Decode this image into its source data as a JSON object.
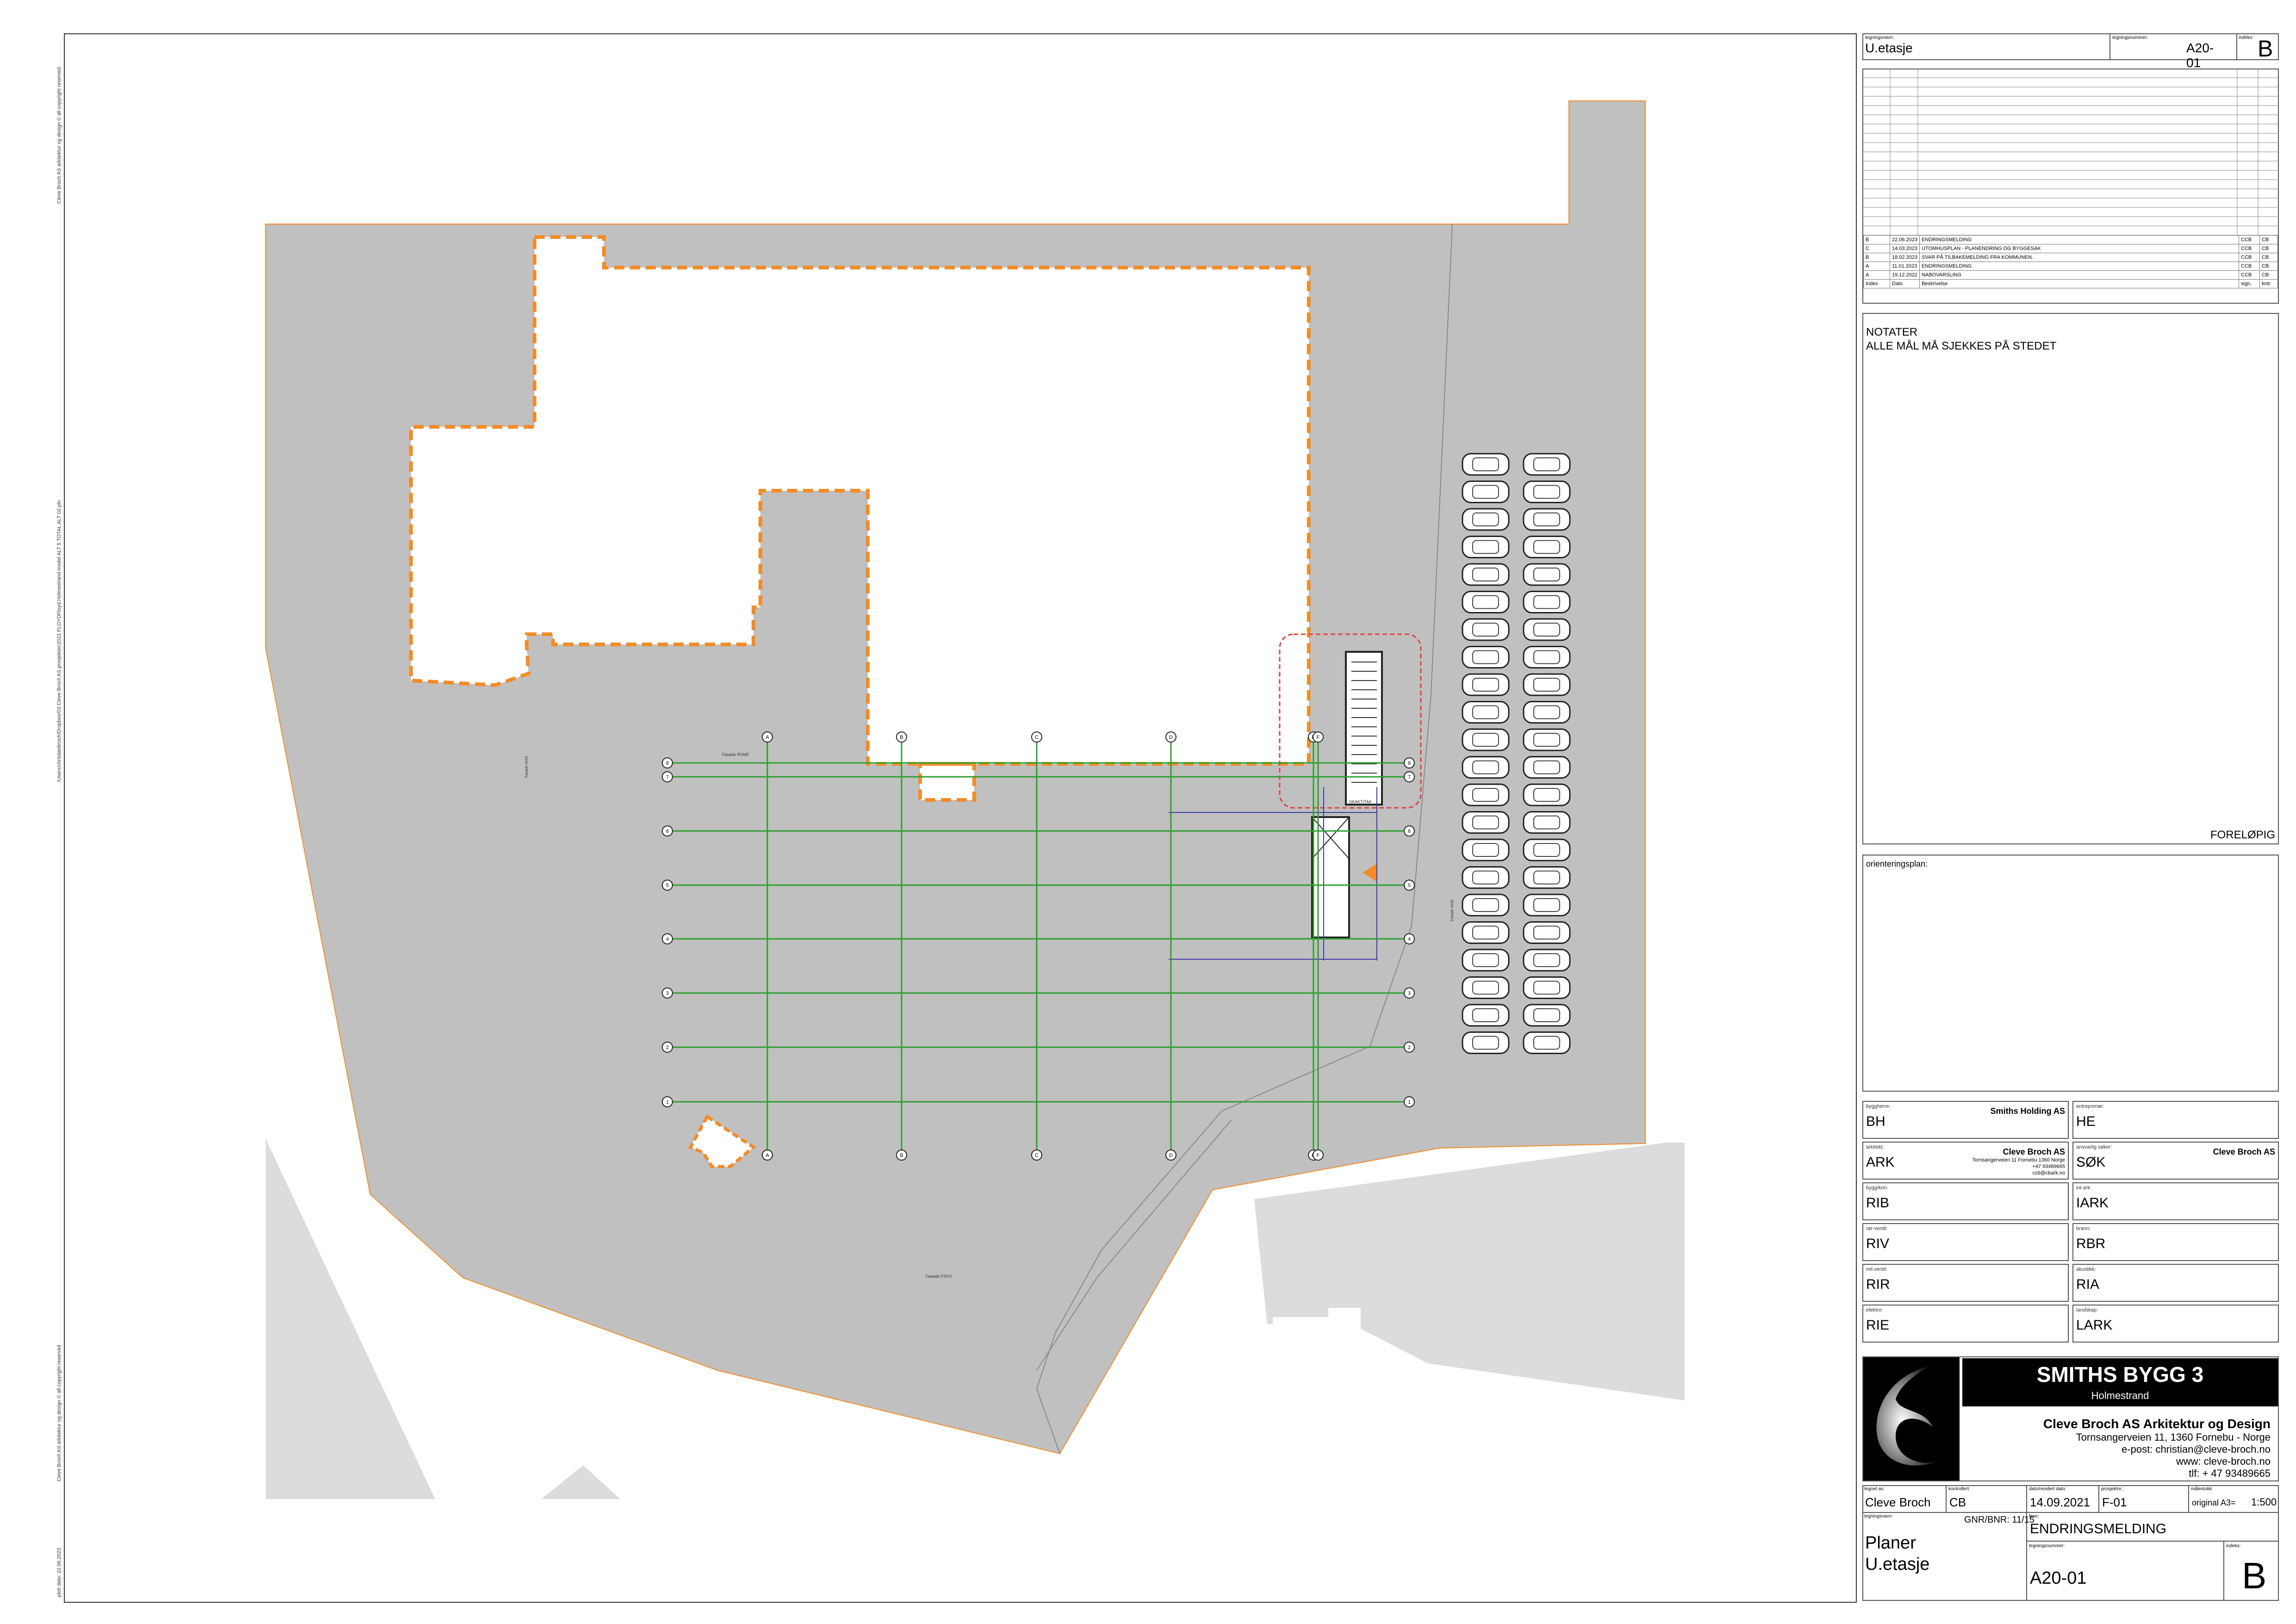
{
  "side_notes": {
    "copyright_top": "Cleve Broch AS arkitektur og design © all copyright reserved",
    "file_path": "/Users/christianbroch/Dropbox/03 Cleve Broch AS prosjekter/2021 FLOYDFloyd Holmestrand model ALT 5 TOTAL ALT 02.pln",
    "copyright_bottom": "Cleve Broch AS arkitektur og design © all copyright reserved",
    "print_date": "plott dato: 22.06.2023"
  },
  "drawing_labels": {
    "fill_label": "SKAKT/TAK",
    "marker_1": "Fasade ROMF",
    "marker_2": "Fasade FSFO",
    "marker_3": "Fasade 4103",
    "marker_4": "Fasade 4100"
  },
  "grid_axes": {
    "columns": [
      "A",
      "B",
      "C",
      "D",
      "E",
      "F"
    ],
    "rows": [
      "8",
      "7",
      "6",
      "5",
      "4",
      "3",
      "2",
      "1"
    ]
  },
  "title_block": {
    "header": {
      "name_label": "tegningsnavn:",
      "name": "U.etasje",
      "number_label": "tegningsnummer:",
      "number": "A20-01",
      "index_label": "indeks:",
      "index": "B"
    },
    "revisions": [
      {
        "index": "B",
        "date": "22.06.2023",
        "desc": "ENDRINGSMELDING",
        "sign": "CCB",
        "ktrl": "CB"
      },
      {
        "index": "C",
        "date": "14.03.2023",
        "desc": "UTOMHUSPLAN - PLANENDRING OG BYGGESAK",
        "sign": "CCB",
        "ktrl": "CB"
      },
      {
        "index": "B",
        "date": "18.02.2023",
        "desc": "SVAR PÅ TILBAKEMELDING FRA KOMMUNEN.",
        "sign": "CCB",
        "ktrl": "CB"
      },
      {
        "index": "A",
        "date": "11.01.2023",
        "desc": "ENDRINGSMELDING",
        "sign": "CCB",
        "ktrl": "CB"
      },
      {
        "index": "A",
        "date": "19.12.2022",
        "desc": "NABOVARSLING",
        "sign": "CCB",
        "ktrl": "CB"
      }
    ],
    "revision_headers": {
      "index": "Index",
      "date": "Dato",
      "desc": "Beskrivelse",
      "sign": "sign.",
      "ktrl": "kntr."
    },
    "notes_title": "NOTATER",
    "notes_text": "ALLE MÅL MÅ SJEKKES PÅ STEDET",
    "status": "FORELØPIG",
    "orientation_label": "orienteringsplan:",
    "parties": [
      {
        "label": "byggherre:",
        "code": "BH",
        "name": "Smiths Holding AS"
      },
      {
        "label": "entreprenør:",
        "code": "HE",
        "name": ""
      },
      {
        "label": "arkitekt:",
        "code": "ARK",
        "name": "Cleve Broch AS",
        "addr1": "Tornsangerveien 11 Fornebu 1360 Norge",
        "addr2": "+47 93489665",
        "addr3": "ccb@cbark.no"
      },
      {
        "label": "ansvarlig søker:",
        "code": "SØK",
        "name": "Cleve Broch AS"
      },
      {
        "label": "bygg/kon:",
        "code": "RIB",
        "name": ""
      },
      {
        "label": "int.ark:",
        "code": "IARK",
        "name": ""
      },
      {
        "label": "rør-ventil:",
        "code": "RIV",
        "name": ""
      },
      {
        "label": "brann:",
        "code": "RBR",
        "name": ""
      },
      {
        "label": "mil.ventil:",
        "code": "RIR",
        "name": ""
      },
      {
        "label": "akustikk:",
        "code": "RIA",
        "name": ""
      },
      {
        "label": "elektro:",
        "code": "RIE",
        "name": ""
      },
      {
        "label": "landskap:",
        "code": "LARK",
        "name": ""
      }
    ],
    "project": {
      "title": "SMITHS BYGG 3",
      "location": "Holmestrand",
      "company": "Cleve Broch AS Arkitektur og Design",
      "address": "Tornsangerveien 11, 1360 Fornebu - Norge",
      "email": "e-post: christian@cleve-broch.no",
      "web": "www: cleve-broch.no",
      "phone": "tlf: + 47 93489665"
    },
    "footer": {
      "drawn_label": "tegnet av:",
      "drawn": "Cleve Broch",
      "checked_label": "kontrollert:",
      "checked": "CB",
      "date_label": "dato/revidert dato:",
      "date": "14.09.2021",
      "project_label": "prosjektnr.:",
      "project_no": "F-01",
      "scale_label": "målestokk:",
      "scale_format": "original A3=",
      "scale": "1:500",
      "drawing_name_label": "tegningsnavn:",
      "gnr": "GNR/BNR: 11/15",
      "phase_label": "fase:",
      "phase": "ENDRINGSMELDING",
      "title_line1": "Planer",
      "title_line2": "U.etasje",
      "number_label": "tegningsnummer:",
      "number": "A20-01",
      "index_label": "indeks:",
      "index": "B"
    }
  },
  "colors": {
    "site_fill": "#c0c0c0",
    "neighbour_fill": "#dcdcdc",
    "boundary_orange": "#f28c28",
    "grid_green": "#2e9e2e",
    "dim_blue": "#3a3aa8",
    "hatch_red": "#e04040",
    "logo_bg": "#000000"
  }
}
